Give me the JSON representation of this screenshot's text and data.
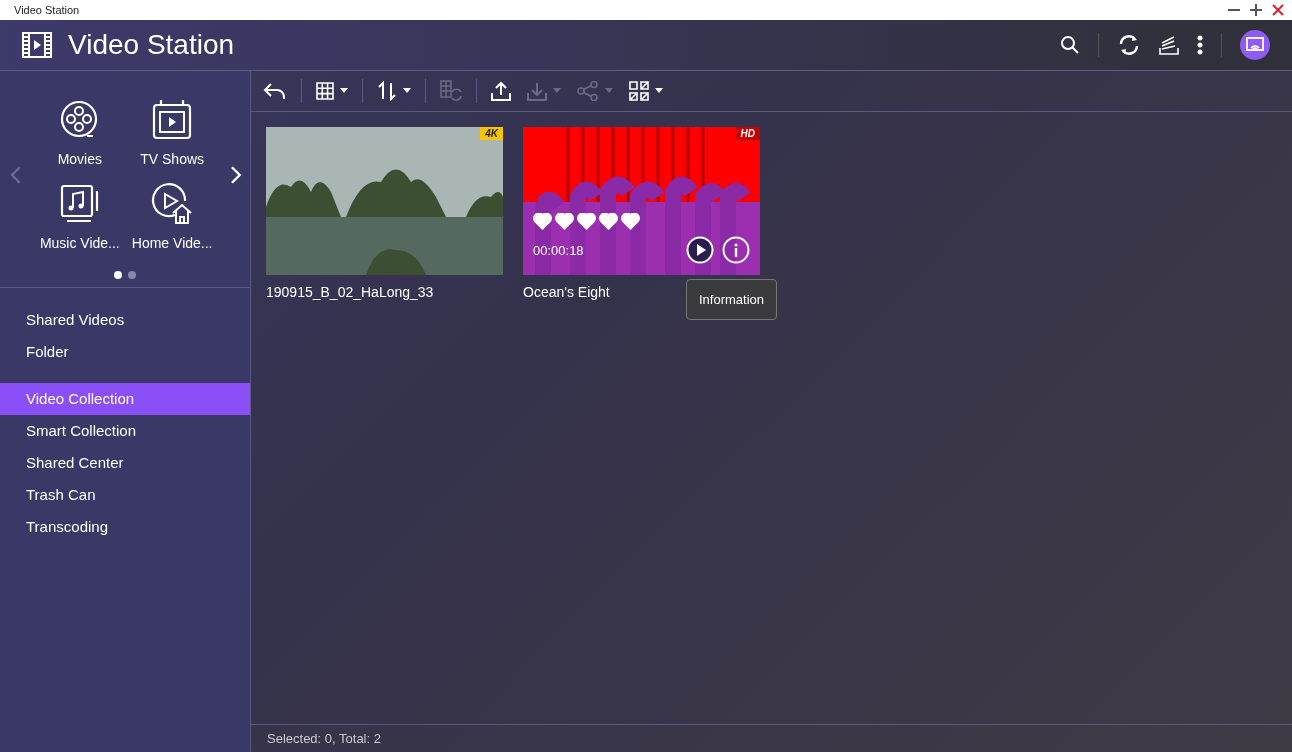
{
  "window": {
    "title": "Video Station"
  },
  "header": {
    "title": "Video Station"
  },
  "sidebar": {
    "categories": [
      {
        "label": "Movies",
        "kind": "movies"
      },
      {
        "label": "TV Shows",
        "kind": "tv"
      },
      {
        "label": "Music Vide...",
        "kind": "music"
      },
      {
        "label": "Home Vide...",
        "kind": "home"
      }
    ],
    "prev_disabled": true,
    "next_disabled": false,
    "pages": [
      {
        "selected": true
      },
      {
        "selected": false
      }
    ],
    "items": [
      {
        "label": "Shared Videos",
        "selected": false
      },
      {
        "label": "Folder",
        "selected": false
      },
      {
        "label": "Video Collection",
        "selected": true
      },
      {
        "label": "Smart Collection",
        "selected": false
      },
      {
        "label": "Shared Center",
        "selected": false
      },
      {
        "label": "Trash Can",
        "selected": false
      },
      {
        "label": "Transcoding",
        "selected": false
      }
    ]
  },
  "toolbar": [
    {
      "kind": "back",
      "disabled": false,
      "dropdown": false
    },
    {
      "kind": "grid",
      "disabled": false,
      "dropdown": true
    },
    {
      "kind": "sort",
      "disabled": false,
      "dropdown": true
    },
    {
      "kind": "convert",
      "disabled": true,
      "dropdown": false
    },
    {
      "kind": "upload",
      "disabled": false,
      "dropdown": false
    },
    {
      "kind": "download",
      "disabled": true,
      "dropdown": true
    },
    {
      "kind": "share",
      "disabled": true,
      "dropdown": true
    },
    {
      "kind": "layout",
      "disabled": false,
      "dropdown": true
    }
  ],
  "videos": [
    {
      "title": "190915_B_02_HaLong_33",
      "badge": "4K",
      "kind": "landscape",
      "hover": false
    },
    {
      "title": "Ocean's Eight",
      "badge": "HD",
      "kind": "poster",
      "hover": true,
      "stars": 5,
      "duration": "00:00:18",
      "tooltip": "Information"
    }
  ],
  "status_bar": "Selected: 0, Total: 2"
}
